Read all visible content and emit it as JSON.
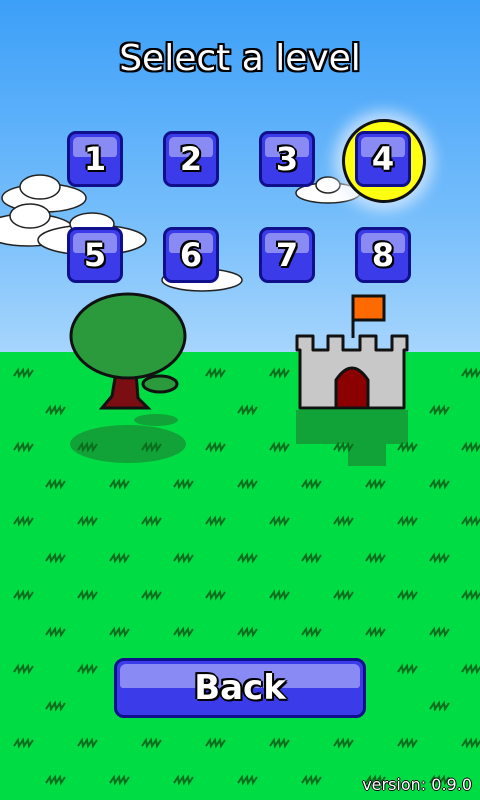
{
  "screen": {
    "title": "Select a level",
    "version": "version: 0.9.0"
  },
  "levels": [
    {
      "label": "1",
      "selected": false
    },
    {
      "label": "2",
      "selected": false
    },
    {
      "label": "3",
      "selected": false
    },
    {
      "label": "4",
      "selected": true
    },
    {
      "label": "5",
      "selected": false
    },
    {
      "label": "6",
      "selected": false
    },
    {
      "label": "7",
      "selected": false
    },
    {
      "label": "8",
      "selected": false
    }
  ],
  "back_button": {
    "label": "Back"
  },
  "colors": {
    "sky": "#3c9ff8",
    "grass": "#00dd44",
    "button_fill": "#3b3bea",
    "button_border": "#10108c",
    "selection_ring": "#ffff11",
    "castle": "#c8c8c8",
    "flag": "#ff6a00"
  },
  "icons": [
    "cloud-icon",
    "tree-icon",
    "castle-icon",
    "grass-tuft-icon"
  ]
}
